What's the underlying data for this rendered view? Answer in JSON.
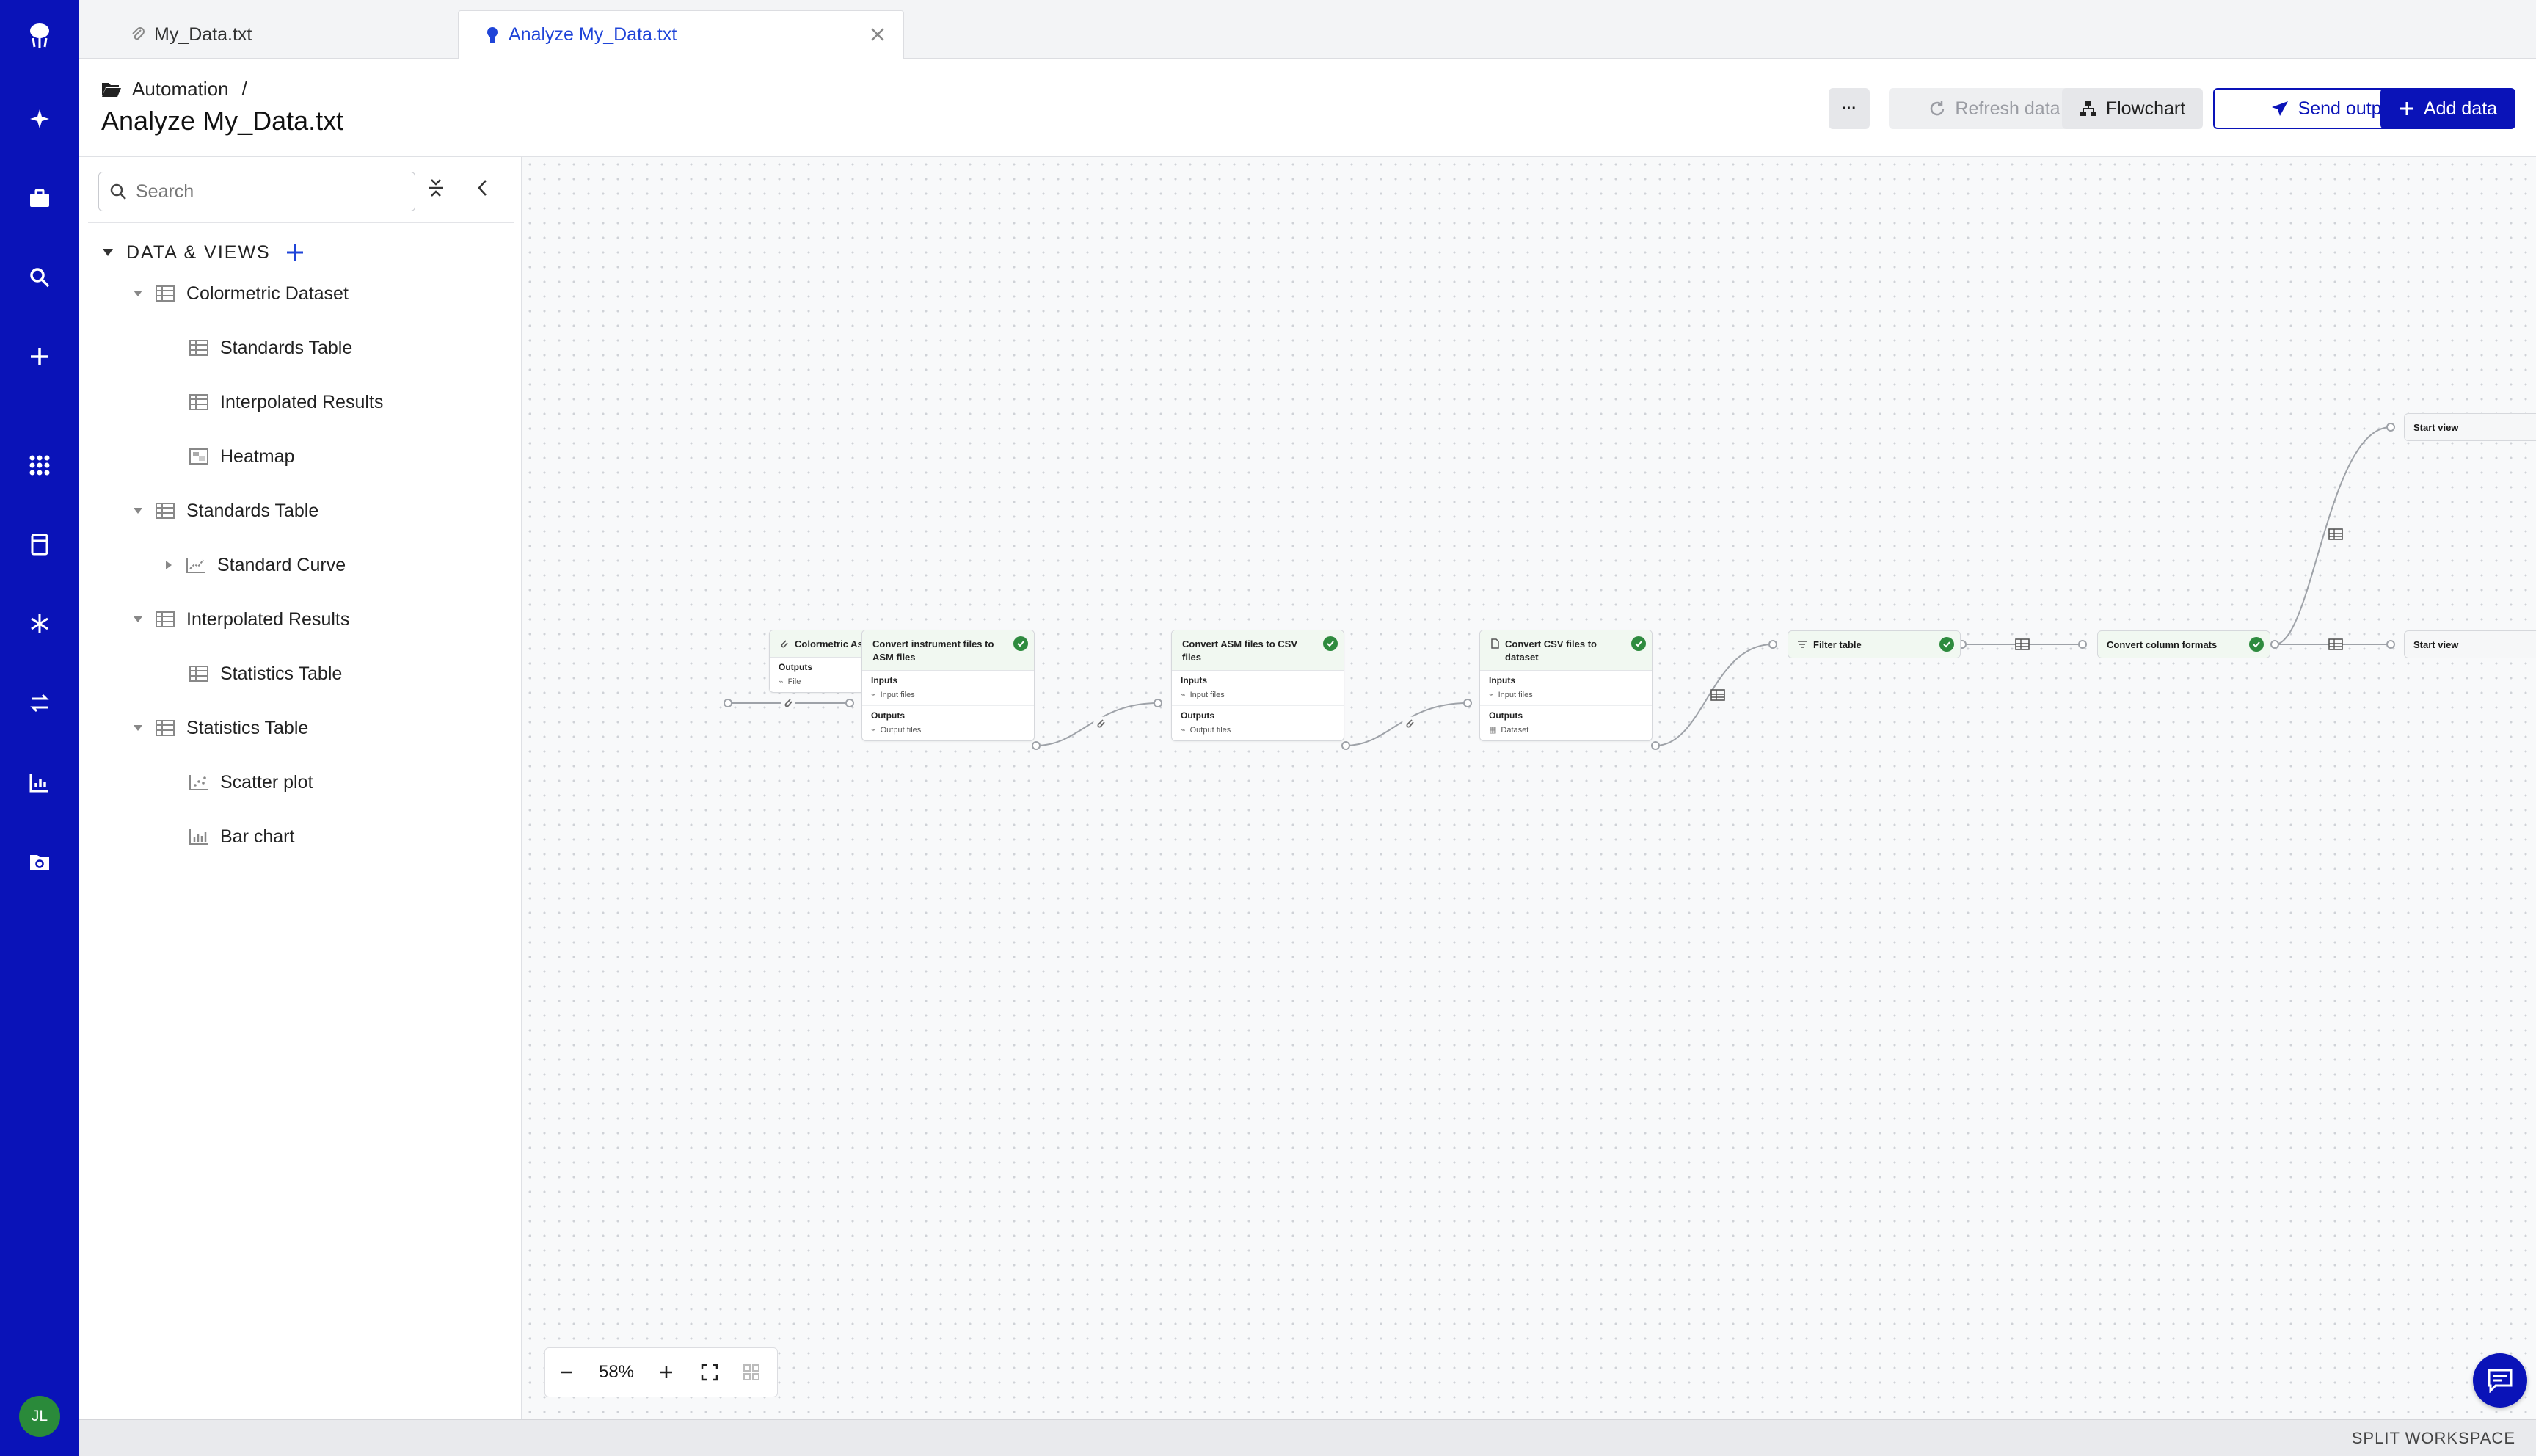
{
  "tabs": [
    {
      "label": "My_Data.txt",
      "icon": "paperclip-icon"
    },
    {
      "label": "Analyze My_Data.txt",
      "icon": "lightbulb-icon"
    }
  ],
  "header": {
    "breadcrumb": "Automation",
    "breadcrumb_sep": "/",
    "title": "Analyze My_Data.txt",
    "more_label": "···",
    "refresh_label": "Refresh data",
    "flowchart_label": "Flowchart",
    "send_label": "Send output",
    "add_label": "Add data"
  },
  "sidebar": {
    "search_placeholder": "Search",
    "section_title": "DATA & VIEWS",
    "items": [
      {
        "label": "Colormetric Dataset",
        "icon": "table-icon",
        "level": 1,
        "caret": "down"
      },
      {
        "label": "Standards Table",
        "icon": "table-icon",
        "level": 2
      },
      {
        "label": "Interpolated Results",
        "icon": "table-icon",
        "level": 2
      },
      {
        "label": "Heatmap",
        "icon": "heatmap-icon",
        "level": 2
      },
      {
        "label": "Standards Table",
        "icon": "table-icon",
        "level": 1,
        "caret": "down"
      },
      {
        "label": "Standard Curve",
        "icon": "line-chart-icon",
        "level": 2,
        "caret": "right"
      },
      {
        "label": "Interpolated Results",
        "icon": "table-icon",
        "level": 1,
        "caret": "down"
      },
      {
        "label": "Statistics Table",
        "icon": "table-icon",
        "level": 2
      },
      {
        "label": "Statistics Table",
        "icon": "table-icon",
        "level": 1,
        "caret": "down"
      },
      {
        "label": "Scatter plot",
        "icon": "scatter-icon",
        "level": 2
      },
      {
        "label": "Bar chart",
        "icon": "bar-chart-icon",
        "level": 2
      }
    ]
  },
  "flow": {
    "nodes": [
      {
        "title": "Colormetric Assay Data",
        "outputs_label": "Outputs",
        "output": "File"
      },
      {
        "title": "Convert instrument files to ASM files",
        "inputs_label": "Inputs",
        "input": "Input files",
        "outputs_label": "Outputs",
        "output": "Output files"
      },
      {
        "title": "Convert ASM files to CSV files",
        "inputs_label": "Inputs",
        "input": "Input files",
        "outputs_label": "Outputs",
        "output": "Output files"
      },
      {
        "title": "Convert CSV files to dataset",
        "inputs_label": "Inputs",
        "input": "Input files",
        "outputs_label": "Outputs",
        "output": "Dataset"
      },
      {
        "title": "Filter table"
      },
      {
        "title": "Convert column formats"
      },
      {
        "title": "Start view"
      },
      {
        "title": "Start view"
      }
    ]
  },
  "zoom": {
    "value": "58%"
  },
  "footer": {
    "split_label": "SPLIT WORKSPACE"
  },
  "user": {
    "initials": "JL"
  },
  "colors": {
    "rail": "#0a13b8",
    "accent": "#1f44d8",
    "success": "#2e8b3e"
  }
}
